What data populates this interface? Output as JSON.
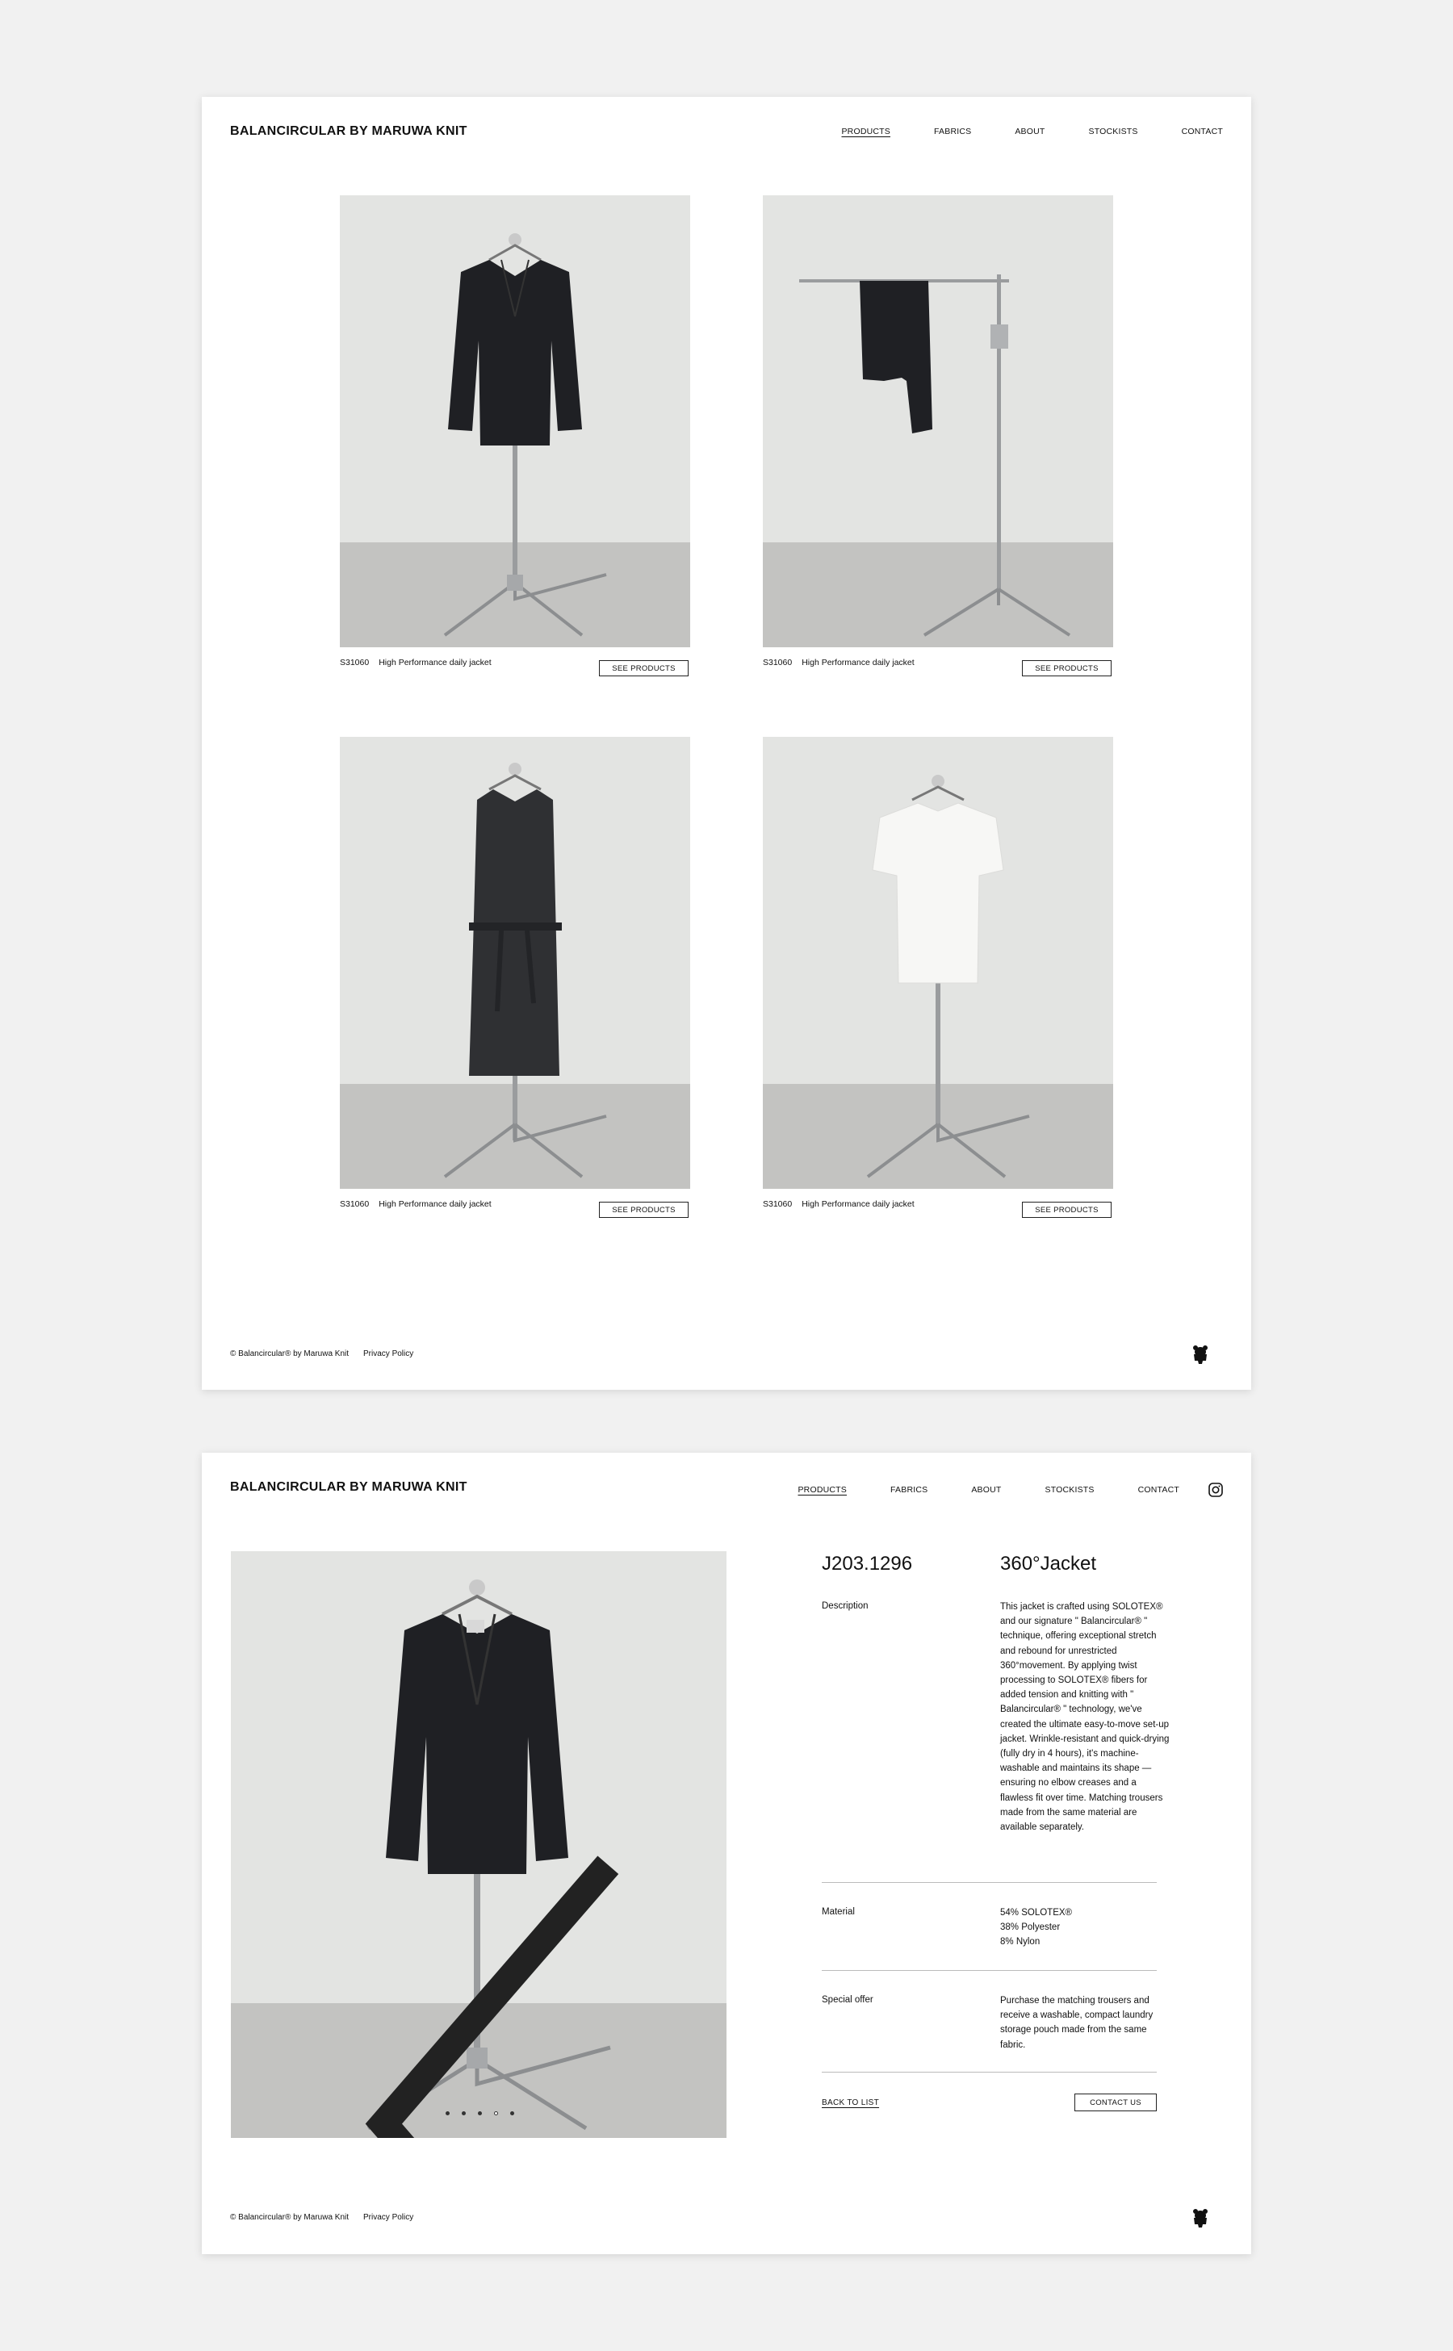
{
  "brand": "BALANCIRCULAR BY MARUWA KNIT",
  "nav": {
    "products": "PRODUCTS",
    "fabrics": "FABRICS",
    "about": "ABOUT",
    "stockists": "STOCKISTS",
    "contact": "CONTACT"
  },
  "list_page": {
    "products": [
      {
        "code": "S31060",
        "name": "High Performance daily jacket",
        "button": "SEE PRODUCTS",
        "item": "jacket"
      },
      {
        "code": "S31060",
        "name": "High Performance daily jacket",
        "button": "SEE PRODUCTS",
        "item": "trousers"
      },
      {
        "code": "S31060",
        "name": "High Performance daily jacket",
        "button": "SEE PRODUCTS",
        "item": "coat"
      },
      {
        "code": "S31060",
        "name": "High Performance daily jacket",
        "button": "SEE PRODUCTS",
        "item": "tshirt"
      }
    ]
  },
  "footer": {
    "copyright": "© Balancircular® by Maruwa Knit",
    "privacy": "Privacy Policy"
  },
  "detail": {
    "code": "J203.1296",
    "title": "360°Jacket",
    "description_label": "Description",
    "description": "This jacket is crafted using SOLOTEX® and our signature \" Balancircular® \" technique, offering exceptional stretch and rebound for unrestricted 360°movement. By applying twist processing to SOLOTEX® fibers for added tension and knitting with \" Balancircular® \" technology, we've created the ultimate easy-to-move set-up jacket. Wrinkle-resistant and quick-drying (fully dry in 4 hours), it's machine-washable and maintains its shape —ensuring no elbow creases and a flawless fit over time. Matching trousers made from the same material are available separately.",
    "material_label": "Material",
    "material": [
      "54% SOLOTEX®",
      "38% Polyester",
      "8% Nylon"
    ],
    "offer_label": "Special offer",
    "offer": "Purchase the matching trousers and receive a washable, compact laundry storage pouch made from the same fabric.",
    "back": "BACK TO LIST",
    "contact_button": "CONTACT US",
    "slides": 5,
    "active_slide": 4
  },
  "colors": {
    "background": "#f1f1f1",
    "card": "#ffffff",
    "text": "#111111",
    "garment_dark": "#1f2024",
    "garment_white": "#f7f7f5",
    "wall": "#e3e4e2",
    "floor": "#c3c3c1"
  },
  "icons": [
    "instagram-icon",
    "bear-logo-icon",
    "chevron-left-icon",
    "chevron-right-icon"
  ]
}
